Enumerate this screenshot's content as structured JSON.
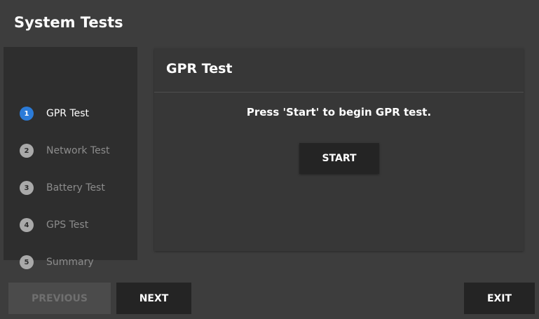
{
  "app": {
    "title": "System Tests"
  },
  "steps": [
    {
      "number": "1",
      "label": "GPR Test",
      "active": true
    },
    {
      "number": "2",
      "label": "Network Test",
      "active": false
    },
    {
      "number": "3",
      "label": "Battery Test",
      "active": false
    },
    {
      "number": "4",
      "label": "GPS Test",
      "active": false
    },
    {
      "number": "5",
      "label": "Summary",
      "active": false
    }
  ],
  "panel": {
    "title": "GPR Test",
    "instruction": "Press 'Start' to begin GPR test.",
    "start_label": "START"
  },
  "footer": {
    "previous_label": "PREVIOUS",
    "next_label": "NEXT",
    "exit_label": "EXIT"
  },
  "colors": {
    "background": "#3d3d3d",
    "sidebar": "#2e2e2e",
    "panel": "#373737",
    "active_step": "#2b7bd8",
    "button": "#242424"
  }
}
